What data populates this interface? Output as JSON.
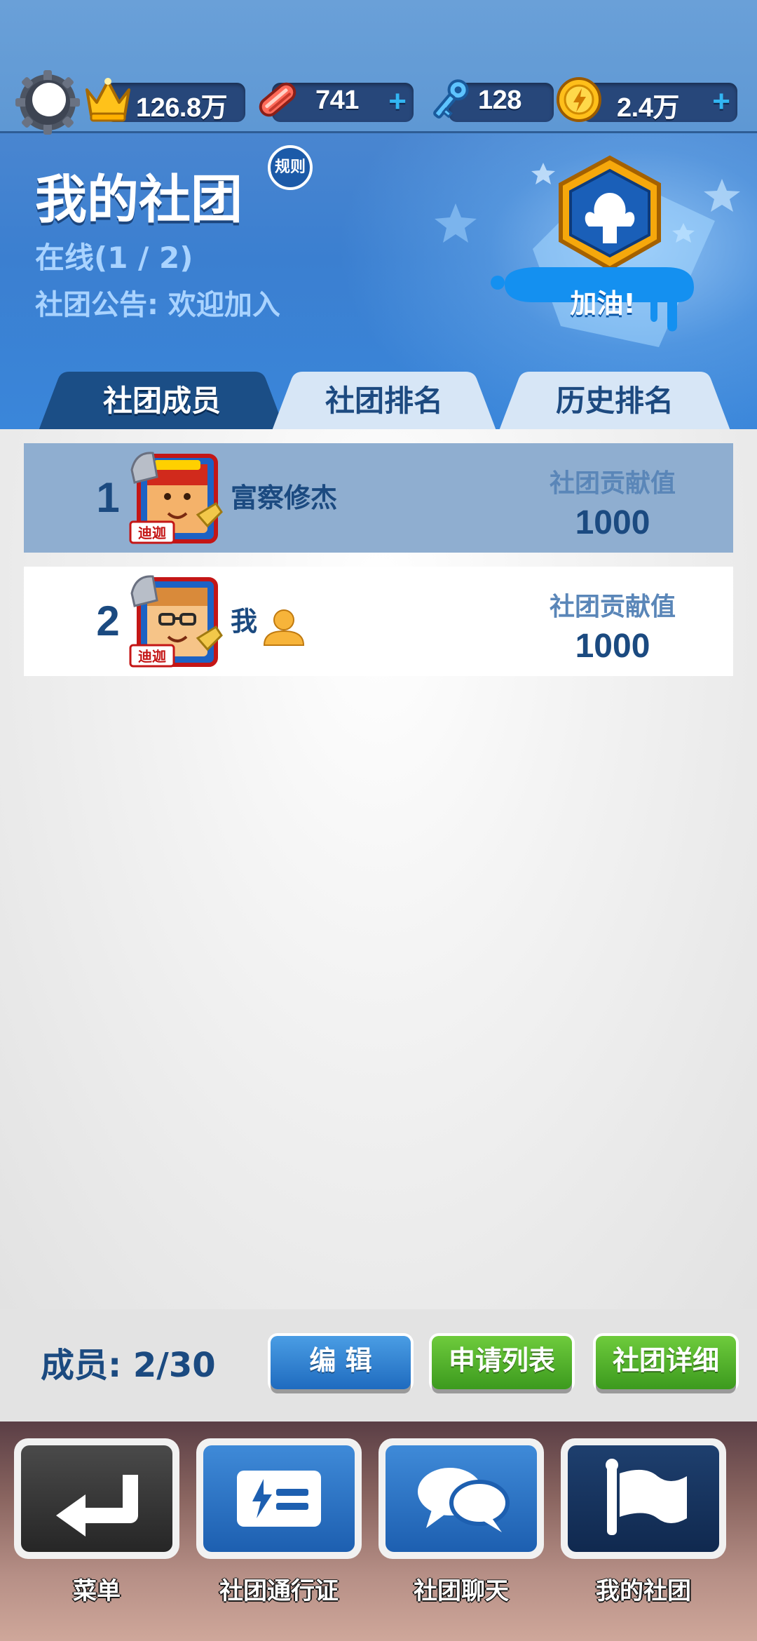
{
  "currency": {
    "crowns": "126.8万",
    "boards": "741",
    "keys": "128",
    "coins": "2.4万",
    "plus": "+"
  },
  "club": {
    "title": "我的社团",
    "rules": "规则",
    "online": "在线(1 / 2)",
    "notice": "社团公告: 欢迎加入",
    "cheer": "加油!"
  },
  "tabs": [
    {
      "label": "社团成员",
      "active": true
    },
    {
      "label": "社团排名",
      "active": false
    },
    {
      "label": "历史排名",
      "active": false
    }
  ],
  "members": [
    {
      "rank": "1",
      "name": "富察修杰",
      "contrib_label": "社团贡献值",
      "contrib": "1000",
      "badge": "迪迦"
    },
    {
      "rank": "2",
      "name": "我",
      "contrib_label": "社团贡献值",
      "contrib": "1000",
      "badge": "迪迦"
    }
  ],
  "footer": {
    "member_count": "成员: 2/30",
    "edit": "编 辑",
    "apply_list": "申请列表",
    "club_detail": "社团详细"
  },
  "nav": [
    {
      "label": "菜单",
      "icon": "return-arrow-icon"
    },
    {
      "label": "社团通行证",
      "icon": "pass-card-icon"
    },
    {
      "label": "社团聊天",
      "icon": "chat-bubbles-icon"
    },
    {
      "label": "我的社团",
      "icon": "flag-icon"
    }
  ],
  "colors": {
    "header_blue": "#4a86d0",
    "title_navy": "#1b4a80",
    "button_blue": "#1f6bbf",
    "button_green": "#3c9a1e",
    "row_highlight": "#8faed0"
  }
}
